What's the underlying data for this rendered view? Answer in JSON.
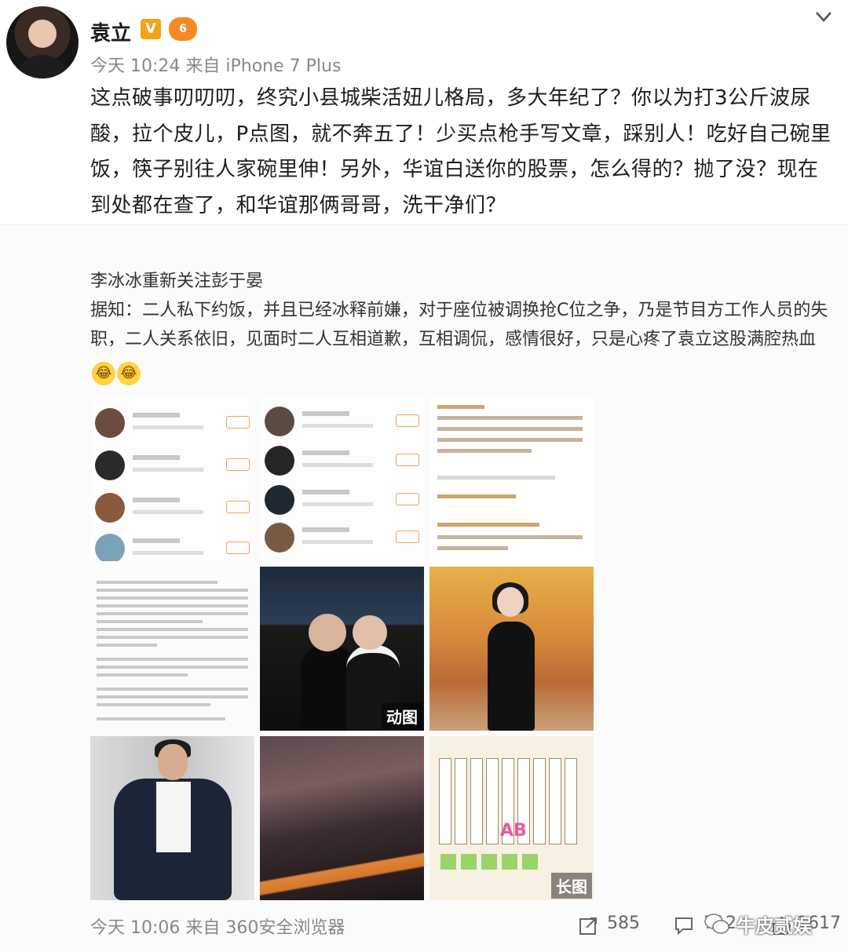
{
  "post": {
    "author": "袁立",
    "verified_badge": "V",
    "level_badge": "6",
    "time_source": "今天 10:24 来自 iPhone 7 Plus",
    "text": "这点破事叨叨叨，终究小县城柴活妞儿格局，多大年纪了？你以为打3公斤波尿酸，拉个皮儿，P点图，就不奔五了！少买点枪手写文章，踩别人！吃好自己碗里饭，筷子别往人家碗里伸！另外，华谊白送你的股票，怎么得的？抛了没？现在到处都在查了，和华谊那俩哥哥，洗干净们？"
  },
  "repost": {
    "title": "李冰冰重新关注彭于晏",
    "body": "据知：二人私下约饭，并且已经冰释前嫌，对于座位被调换抢C位之争，乃是节目方工作人员的失职，二人关系依旧，见面时二人互相道歉，互相调侃，感情很好，只是心疼了袁立这股满腔热血",
    "emoji_1": "😂",
    "emoji_2": "😂",
    "gif_label": "动图",
    "long_label": "长图",
    "chart_label": "AB",
    "time_source": "今天 10:06 来自 360安全浏览器",
    "shares": "585",
    "comments": "712",
    "likes": "1617"
  },
  "watermark": "牛皮贰娱",
  "colors": {
    "accent_orange": "#f7a215",
    "level_orange": "#f58a25",
    "meta_gray": "#888888"
  },
  "icons": {
    "share": "share-icon",
    "comment": "comment-icon",
    "like": "thumbs-up-icon",
    "menu": "chevron-down-icon"
  }
}
